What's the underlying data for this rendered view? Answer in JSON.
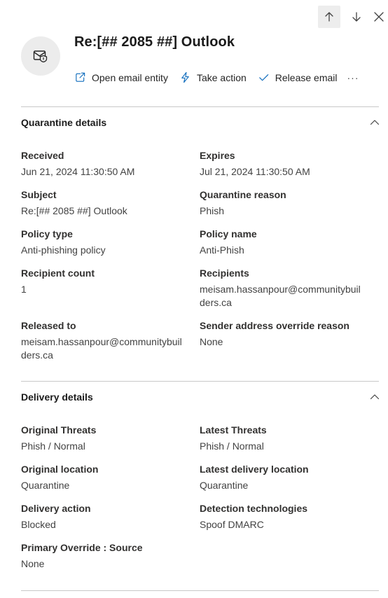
{
  "nav": {
    "up_icon": "arrow-up-icon",
    "down_icon": "arrow-down-icon",
    "close_icon": "close-icon"
  },
  "header": {
    "avatar_icon": "email-shield-icon",
    "title": "Re:[## 2085 ##] Outlook",
    "actions": [
      {
        "label": "Open email entity",
        "icon": "open-external-icon"
      },
      {
        "label": "Take action",
        "icon": "lightning-icon"
      },
      {
        "label": "Release email",
        "icon": "checkmark-icon"
      },
      {
        "label": "···",
        "icon": "more-icon"
      }
    ]
  },
  "quarantine": {
    "title": "Quarantine details",
    "fields": [
      {
        "label": "Received",
        "value": "Jun 21, 2024 11:30:50 AM"
      },
      {
        "label": "Expires",
        "value": "Jul 21, 2024 11:30:50 AM"
      },
      {
        "label": "Subject",
        "value": "Re:[## 2085 ##] Outlook"
      },
      {
        "label": "Quarantine reason",
        "value": "Phish"
      },
      {
        "label": "Policy type",
        "value": "Anti-phishing policy"
      },
      {
        "label": "Policy name",
        "value": "Anti-Phish"
      },
      {
        "label": "Recipient count",
        "value": "1"
      },
      {
        "label": "Recipients",
        "value": "meisam.hassanpour@communitybuilders.ca"
      },
      {
        "label": "Released to",
        "value": "meisam.hassanpour@communitybuilders.ca"
      },
      {
        "label": "Sender address override reason",
        "value": "None"
      }
    ]
  },
  "delivery": {
    "title": "Delivery details",
    "fields": [
      {
        "label": "Original Threats",
        "value": "Phish / Normal"
      },
      {
        "label": "Latest Threats",
        "value": "Phish / Normal"
      },
      {
        "label": "Original location",
        "value": "Quarantine"
      },
      {
        "label": "Latest delivery location",
        "value": "Quarantine"
      },
      {
        "label": "Delivery action",
        "value": "Blocked"
      },
      {
        "label": "Detection technologies",
        "value": "Spoof DMARC"
      },
      {
        "label": "Primary Override : Source",
        "value": "None"
      }
    ]
  },
  "colors": {
    "accent": "#0f6cbd",
    "divider": "#c8c8c8",
    "avatar_bg": "#ececec"
  }
}
